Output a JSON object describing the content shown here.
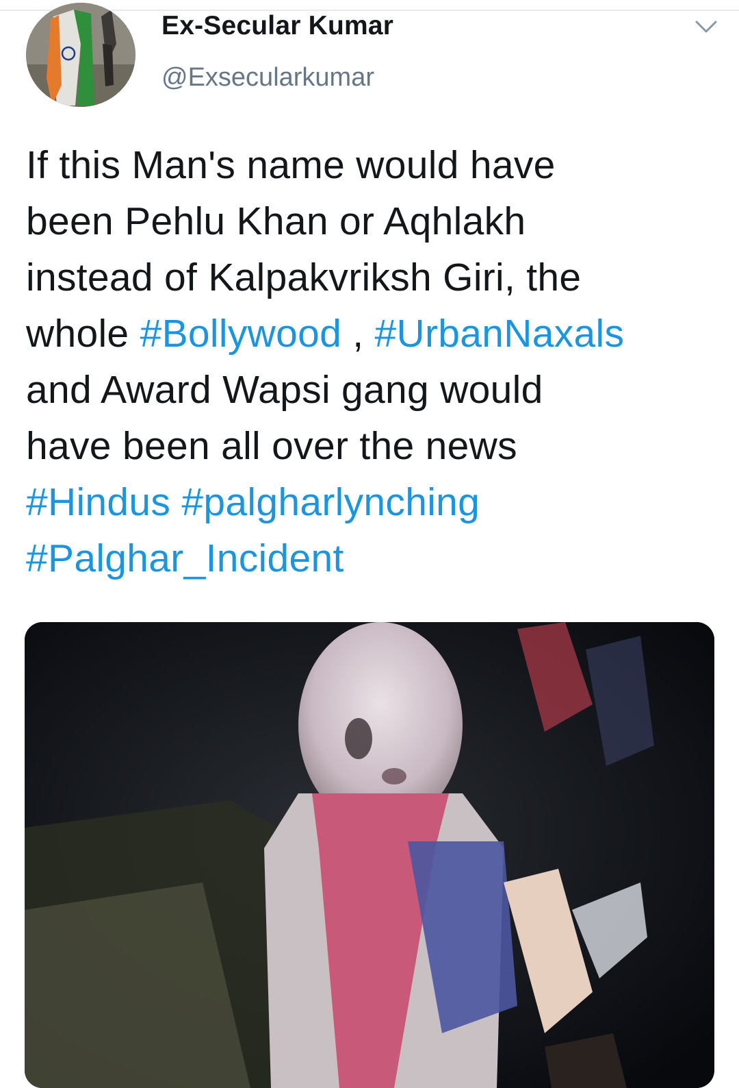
{
  "author": {
    "display_name": "Ex-Secular Kumar",
    "handle": "@Exsecularkumar"
  },
  "tweet": {
    "line1": "If this Man's name would have",
    "line2": "been Pehlu Khan or Aqhlakh",
    "line3": "instead of Kalpakvriksh Giri, the",
    "line4_pre": "whole ",
    "hashtag_bollywood": "#Bollywood",
    "line4_sep": " , ",
    "hashtag_urbannaxals": "#UrbanNaxals",
    "line5": "and Award Wapsi gang would",
    "line6": "have been all over the news",
    "hashtag_hindus": "#Hindus",
    "line7_sep": " ",
    "hashtag_palgharlynching": "#palgharlynching",
    "hashtag_palghar_incident": "#Palghar_Incident"
  },
  "icons": {
    "menu": "chevron-down-icon"
  },
  "colors": {
    "hashtag": "#1b95e0",
    "text": "#14171a",
    "handle": "#657786"
  }
}
